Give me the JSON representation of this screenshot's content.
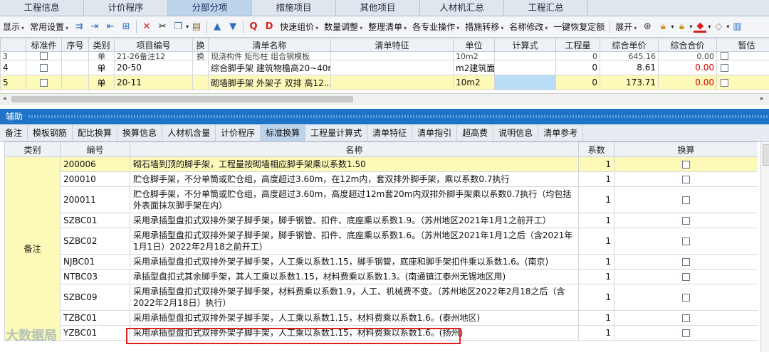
{
  "main_tabs": [
    {
      "label": "工程信息",
      "active": false
    },
    {
      "label": "计价程序",
      "active": false
    },
    {
      "label": "分部分项",
      "active": true
    },
    {
      "label": "措施项目",
      "active": false
    },
    {
      "label": "其他项目",
      "active": false
    },
    {
      "label": "人材机汇总",
      "active": false
    },
    {
      "label": "工程汇总",
      "active": false
    }
  ],
  "toolbar": {
    "display": "显示",
    "common_settings": "常用设置",
    "quick_group": "快速组价",
    "qty_adjust": "数量调整",
    "organize_list": "整理清单",
    "spec_ops": "各专业操作",
    "measure_transfer": "措施转移",
    "name_modify": "名称修改",
    "restore_quota": "一键恢复定额",
    "expand": "展开",
    "icons": [
      "insert-icon",
      "indent-icon",
      "outdent-icon",
      "tree-icon",
      "delete-icon",
      "cut-icon",
      "copy-icon",
      "paste-icon",
      "move-up-icon",
      "move-down-icon",
      "q-quota-icon",
      "d-quota-icon",
      "binoculars-icon",
      "lock-icon",
      "lock2-icon",
      "fill-color-icon",
      "eraser-icon",
      "chart-icon"
    ]
  },
  "top_grid": {
    "columns": [
      "",
      "标准件",
      "序号",
      "类别",
      "项目编号",
      "换",
      "清单名称",
      "清单特征",
      "单位",
      "计算式",
      "工程量",
      "综合单价",
      "综合合价",
      "暂估"
    ],
    "rows": [
      {
        "n": "3",
        "type": "单",
        "code": "21-26备注12",
        "swap": "换",
        "name": "现浇构件 矩形柱 组合钢模板",
        "feat": "",
        "unit": "10m2",
        "formula": "",
        "qty": "0",
        "price": "645.16",
        "total": "0.00",
        "partial": true
      },
      {
        "n": "4",
        "type": "单",
        "code": "20-50",
        "swap": "",
        "name": "综合脚手架 建筑物檐高20~40m",
        "feat": "",
        "unit": "m2建筑面",
        "formula": "",
        "qty": "0",
        "price": "8.61",
        "total": "0.00",
        "partial": false
      },
      {
        "n": "5",
        "type": "单",
        "code": "20-11",
        "swap": "",
        "name": "砌墙脚手架 外架子 双排 高12...",
        "feat": "",
        "unit": "10m2",
        "formula": "",
        "qty": "0",
        "price": "173.71",
        "total": "0.00",
        "partial": false,
        "selected": true
      }
    ]
  },
  "aux_title": "辅助",
  "sub_tabs": [
    {
      "label": "备注",
      "active": false
    },
    {
      "label": "模板钢筋",
      "active": false
    },
    {
      "label": "配比换算",
      "active": false
    },
    {
      "label": "换算信息",
      "active": false
    },
    {
      "label": "人材机含量",
      "active": false
    },
    {
      "label": "计价程序",
      "active": false
    },
    {
      "label": "标准换算",
      "active": true
    },
    {
      "label": "工程量计算式",
      "active": false
    },
    {
      "label": "清单特征",
      "active": false
    },
    {
      "label": "清单指引",
      "active": false
    },
    {
      "label": "超高费",
      "active": false
    },
    {
      "label": "说明信息",
      "active": false
    },
    {
      "label": "清单参考",
      "active": false
    }
  ],
  "std_grid": {
    "columns": [
      "类别",
      "编号",
      "名称",
      "系数",
      "换算"
    ],
    "category": "备注",
    "rows": [
      {
        "code": "200006",
        "name": "砌石墙到顶的脚手架，工程量按砌墙相应脚手架乘以系数1.50",
        "coef": "1",
        "highlight": true
      },
      {
        "code": "200010",
        "name": "贮仓脚手架，不分单筒或贮仓组，高度超过3.60m，在12m内，套双排外脚手架，乘以系数0.7执行",
        "coef": "1"
      },
      {
        "code": "200011",
        "name": "贮仓脚手架，不分单筒或贮仓组，高度超过3.60m，高度超过12m套20m内双排外脚手架乘以系数0.7执行（均包括外表面抹灰脚手架在内）",
        "coef": "1"
      },
      {
        "code": "SZBC01",
        "name": "采用承插型盘扣式双排外架子脚手架，脚手钢管、扣件、底座乘以系数1.9。（苏州地区2021年1月1之前开工）",
        "coef": "1"
      },
      {
        "code": "SZBC02",
        "name": "采用承插型盘扣式双排外架子脚手架，脚手钢管、扣件、底座乘以系数1.6。（苏州地区2021年1月1之后（含2021年1月1日）2022年2月18之前开工）",
        "coef": "1"
      },
      {
        "code": "NJBC01",
        "name": "采用承插型盘扣式双排外架子脚手架，人工乘以系数1.15，脚手钢管，底座和脚手架扣件乘以系数1.6。(南京)",
        "coef": "1"
      },
      {
        "code": "NTBC03",
        "name": "承插型盘扣式其余脚手架，其人工乘以系数1.15，材料费乘以系数1.3。(南通镇江泰州无锡地区用)",
        "coef": "1"
      },
      {
        "code": "SZBC09",
        "name": "采用承插型盘扣式双排外架子脚手架，材料费乘以系数1.9，人工、机械费不变。（苏州地区2022年2月18之后（含2022年2月18日）执行）",
        "coef": "1"
      },
      {
        "code": "TZBC01",
        "name": "采用承插型盘扣式双排外架子脚手架，人工乘以系数1.15，材料费乘以系数1.6。(泰州地区)",
        "coef": "1"
      },
      {
        "code": "YZBC01",
        "name": "采用承插型盘扣式双排外架子脚手架，人工乘以系数1.15，材料费乘以系数1.6。(扬州)",
        "coef": "1"
      }
    ]
  },
  "watermark": "大数据局"
}
